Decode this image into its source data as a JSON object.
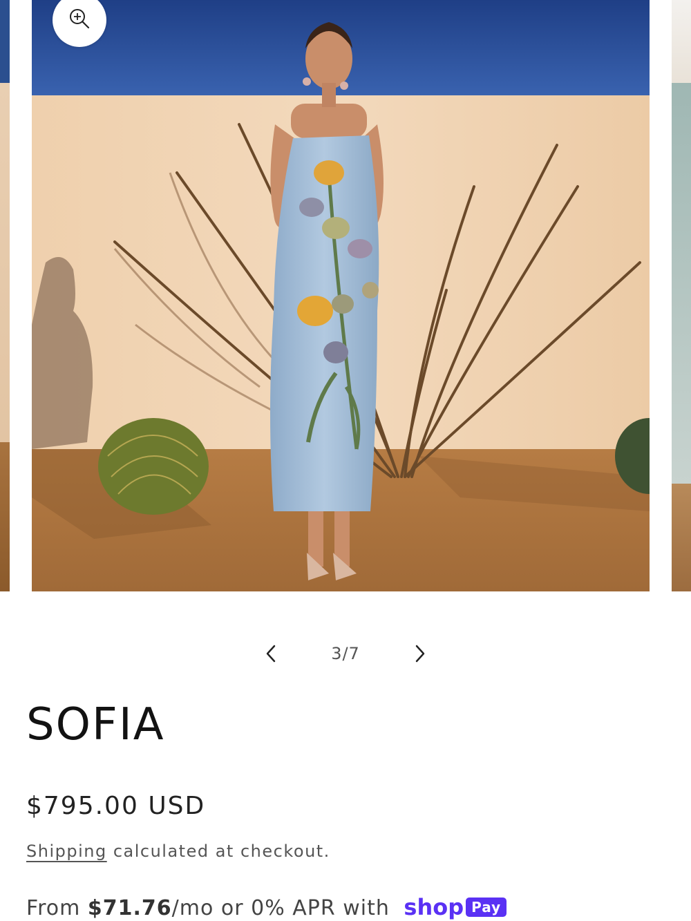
{
  "gallery": {
    "zoom_icon": "zoom-in-icon",
    "image_alt": "Model wearing light blue strapless embroidered floral midi dress in desert setting",
    "counter": "3/7",
    "prev_icon": "chevron-left-icon",
    "next_icon": "chevron-right-icon",
    "current_index": 3,
    "total": 7
  },
  "product": {
    "title": "SOFIA",
    "price": "$795.00 USD",
    "shipping_link": "Shipping",
    "shipping_rest": " calculated at checkout.",
    "installment_prefix": "From ",
    "installment_amount": "$71.76",
    "installment_suffix": "/mo or 0% APR with ",
    "shop_word": "shop",
    "pay_word": "Pay"
  },
  "colors": {
    "sky": "#23468f",
    "wall": "#efd3b4",
    "ground": "#b07840",
    "dress": "#9fb9d6",
    "shop_pay": "#5a31f4"
  }
}
